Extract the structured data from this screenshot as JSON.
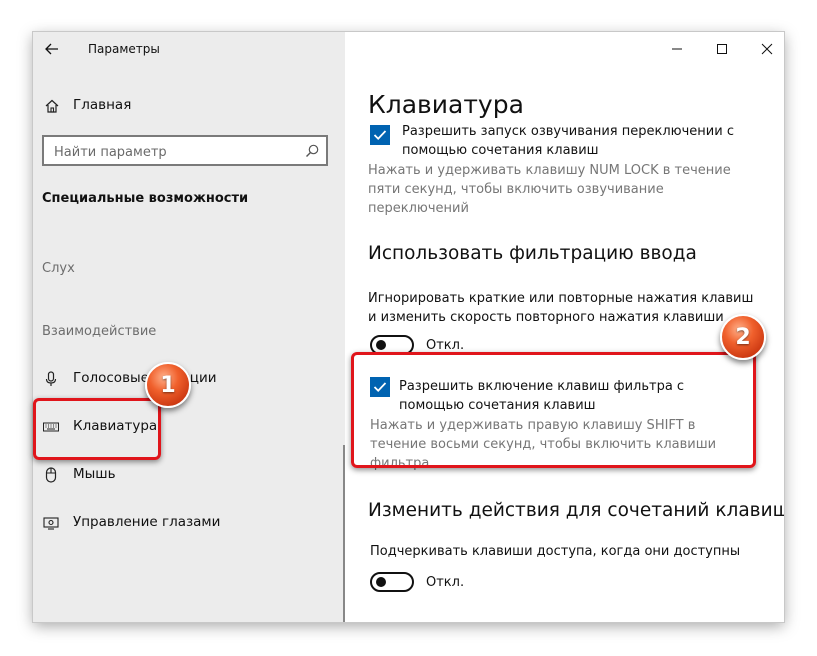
{
  "window": {
    "title": "Параметры"
  },
  "sidebar": {
    "home_label": "Главная",
    "search_placeholder": "Найти параметр",
    "section_title": "Специальные возможности",
    "group_hearing": "Слух",
    "group_interaction": "Взаимодействие",
    "items": [
      {
        "label": "Голосовые функции",
        "icon": "microphone-icon"
      },
      {
        "label": "Клавиатура",
        "icon": "keyboard-icon",
        "selected": true
      },
      {
        "label": "Мышь",
        "icon": "mouse-icon"
      },
      {
        "label": "Управление глазами",
        "icon": "eye-control-icon"
      }
    ]
  },
  "main": {
    "title": "Клавиатура",
    "toggle_keys": {
      "checkbox_label": "Разрешить запуск озвучивания переключении с помощью сочетания клавиш",
      "checked": true,
      "description": "Нажать и удерживать клавишу NUM LOCK в течение пяти секунд, чтобы включить озвучивание переключений"
    },
    "filter_keys": {
      "heading": "Использовать фильтрацию ввода",
      "description": "Игнорировать краткие или повторные нажатия клавиш и изменить скорость повторного нажатия клавиши",
      "toggle_state": "Откл.",
      "checkbox_label": "Разрешить включение клавиш фильтра с помощью сочетания клавиш",
      "checked": true,
      "checkbox_description": "Нажать и удерживать правую клавишу SHIFT в течение восьми секунд, чтобы включить клавиши фильтра"
    },
    "shortcuts": {
      "heading": "Изменить действия для сочетаний клавиш",
      "description": "Подчеркивать клавиши доступа, когда они доступны",
      "toggle_state": "Откл."
    }
  },
  "annotations": {
    "badge_1": "1",
    "badge_2": "2",
    "highlight_color": "#e0151b",
    "badge_color": "#e8501e"
  },
  "colors": {
    "accent": "#0063b1",
    "sidebar_bg": "#ececec"
  }
}
